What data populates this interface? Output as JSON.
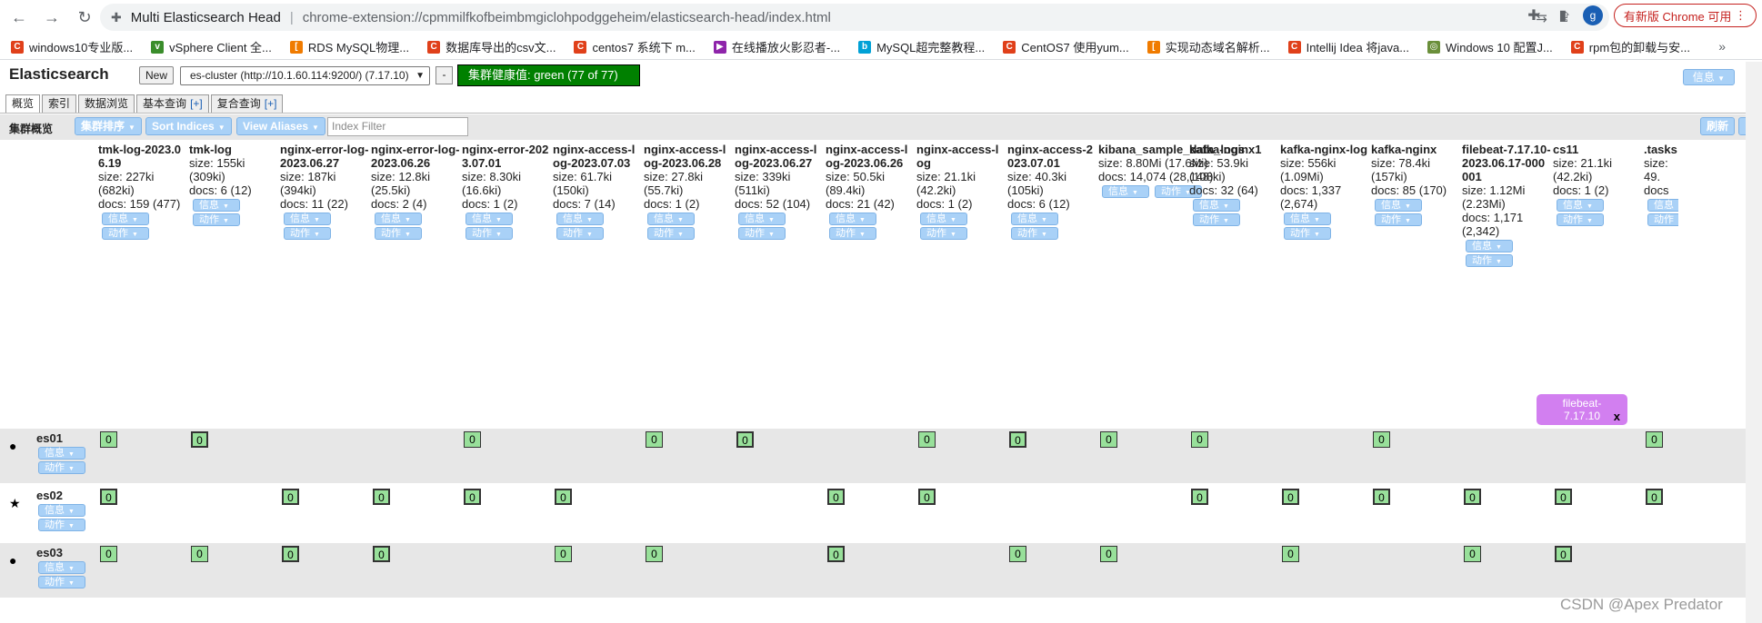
{
  "browser": {
    "tab_title": "Multi Elasticsearch Head",
    "url": "chrome-extension://cpmmilfkofbeimbmgiclohpodggeheim/elasticsearch-head/index.html",
    "update_label": "有新版 Chrome 可用",
    "avatar_letter": "g"
  },
  "bookmarks": [
    {
      "label": "windows10专业版...",
      "color": "#e0401a",
      "icon": "C"
    },
    {
      "label": "vSphere Client 全...",
      "color": "#3a8d2b",
      "icon": "v"
    },
    {
      "label": "RDS MySQL物理...",
      "color": "#f07b00",
      "icon": "["
    },
    {
      "label": "数据库导出的csv文...",
      "color": "#e0401a",
      "icon": "C"
    },
    {
      "label": "centos7 系统下 m...",
      "color": "#e0401a",
      "icon": "C"
    },
    {
      "label": "在线播放火影忍者-...",
      "color": "#8e24aa",
      "icon": "▶"
    },
    {
      "label": "MySQL超完整教程...",
      "color": "#00a1d6",
      "icon": "b"
    },
    {
      "label": "CentOS7 使用yum...",
      "color": "#e0401a",
      "icon": "C"
    },
    {
      "label": "实现动态域名解析...",
      "color": "#f07b00",
      "icon": "["
    },
    {
      "label": "Intellij Idea 将java...",
      "color": "#e0401a",
      "icon": "C"
    },
    {
      "label": "Windows 10 配置J...",
      "color": "#6a8f3a",
      "icon": "◎"
    },
    {
      "label": "rpm包的卸载与安...",
      "color": "#e0401a",
      "icon": "C"
    }
  ],
  "header": {
    "title": "Elasticsearch",
    "new_label": "New",
    "cluster_select": "es-cluster (http://10.1.60.114:9200/) (7.17.10)",
    "minus_label": "-",
    "health": "集群健康值: green (77 of 77)",
    "info_label": "信息"
  },
  "tabs": [
    {
      "label": "概览",
      "plus": ""
    },
    {
      "label": "索引",
      "plus": ""
    },
    {
      "label": "数据浏览",
      "plus": ""
    },
    {
      "label": "基本查询",
      "plus": "[+]"
    },
    {
      "label": "复合查询",
      "plus": "[+]"
    }
  ],
  "overview": {
    "label": "集群概览",
    "sort_cluster": "集群排序",
    "sort_indices": "Sort Indices",
    "view_aliases": "View Aliases",
    "index_filter_placeholder": "Index Filter",
    "refresh": "刷新"
  },
  "buttons": {
    "info": "信息",
    "action": "动作"
  },
  "indices": [
    {
      "name": "tmk-log-2023.06.19",
      "size": "size: 227ki (682ki)",
      "docs": "docs: 159 (477)"
    },
    {
      "name": "tmk-log",
      "size": "size: 155ki (309ki)",
      "docs": "docs: 6 (12)"
    },
    {
      "name": "nginx-error-log-2023.06.27",
      "size": "size: 187ki (394ki)",
      "docs": "docs: 11 (22)"
    },
    {
      "name": "nginx-error-log-2023.06.26",
      "size": "size: 12.8ki (25.5ki)",
      "docs": "docs: 2 (4)"
    },
    {
      "name": "nginx-error-2023.07.01",
      "size": "size: 8.30ki (16.6ki)",
      "docs": "docs: 1 (2)"
    },
    {
      "name": "nginx-access-log-2023.07.03",
      "size": "size: 61.7ki (150ki)",
      "docs": "docs: 7 (14)"
    },
    {
      "name": "nginx-access-log-2023.06.28",
      "size": "size: 27.8ki (55.7ki)",
      "docs": "docs: 1 (2)"
    },
    {
      "name": "nginx-access-log-2023.06.27",
      "size": "size: 339ki (511ki)",
      "docs": "docs: 52 (104)"
    },
    {
      "name": "nginx-access-log-2023.06.26",
      "size": "size: 50.5ki (89.4ki)",
      "docs": "docs: 21 (42)"
    },
    {
      "name": "nginx-access-log",
      "size": "size: 21.1ki (42.2ki)",
      "docs": "docs: 1 (2)"
    },
    {
      "name": "nginx-access-2023.07.01",
      "size": "size: 40.3ki (105ki)",
      "docs": "docs: 6 (12)"
    },
    {
      "name": "kibana_sample_data_logs",
      "size": "size: 8.80Mi (17.6Mi)",
      "docs": "docs: 14,074 (28,148)"
    },
    {
      "name": "kafka-nginx1",
      "size": "size: 53.9ki (108ki)",
      "docs": "docs: 32 (64)"
    },
    {
      "name": "kafka-nginx-log",
      "size": "size: 556ki (1.09Mi)",
      "docs": "docs: 1,337 (2,674)"
    },
    {
      "name": "kafka-nginx",
      "size": "size: 78.4ki (157ki)",
      "docs": "docs: 85 (170)"
    },
    {
      "name": "filebeat-7.17.10-2023.06.17-000001",
      "size": "size: 1.12Mi (2.23Mi)",
      "docs": "docs: 1,171 (2,342)"
    },
    {
      "name": "cs11",
      "size": "size: 21.1ki (42.2ki)",
      "docs": "docs: 1 (2)"
    },
    {
      "name": ".tasks",
      "size": "size: 49.",
      "docs": "docs"
    }
  ],
  "nodes": [
    {
      "name": "es01",
      "mark": "●",
      "shards": [
        0,
        1,
        4,
        6,
        7,
        9,
        10,
        11,
        12,
        14,
        17
      ]
    },
    {
      "name": "es02",
      "mark": "★",
      "shards": [
        0,
        2,
        3,
        4,
        5,
        8,
        9,
        12,
        13,
        14,
        15,
        16,
        17
      ]
    },
    {
      "name": "es03",
      "mark": "●",
      "shards": [
        0,
        1,
        2,
        3,
        5,
        6,
        8,
        10,
        11,
        13,
        15,
        16
      ]
    }
  ],
  "shard_value": "0",
  "tooltip": {
    "line1": "filebeat-",
    "line2": "7.17.10",
    "close": "x"
  },
  "watermark": "CSDN @Apex   Predator"
}
